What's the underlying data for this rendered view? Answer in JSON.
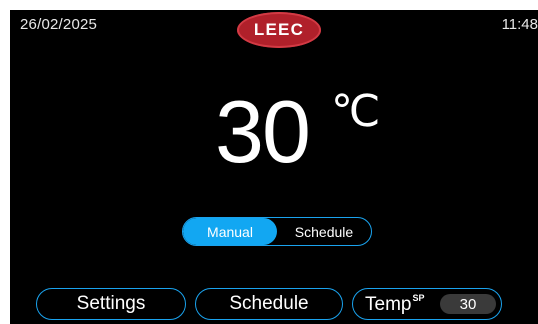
{
  "status_bar": {
    "date": "26/02/2025",
    "time": "11:48",
    "logo_text": "LEEC"
  },
  "temperature": {
    "value": "30",
    "unit": "℃"
  },
  "mode_toggle": {
    "options": [
      "Manual",
      "Schedule"
    ],
    "selected": "Manual"
  },
  "bottom_bar": {
    "settings_label": "Settings",
    "schedule_label": "Schedule",
    "temp_label": "Temp",
    "temp_superscript": "SP",
    "temp_setpoint": "30"
  },
  "colors": {
    "accent": "#12a7f2",
    "logo": "#b0202a",
    "background": "#000000"
  }
}
